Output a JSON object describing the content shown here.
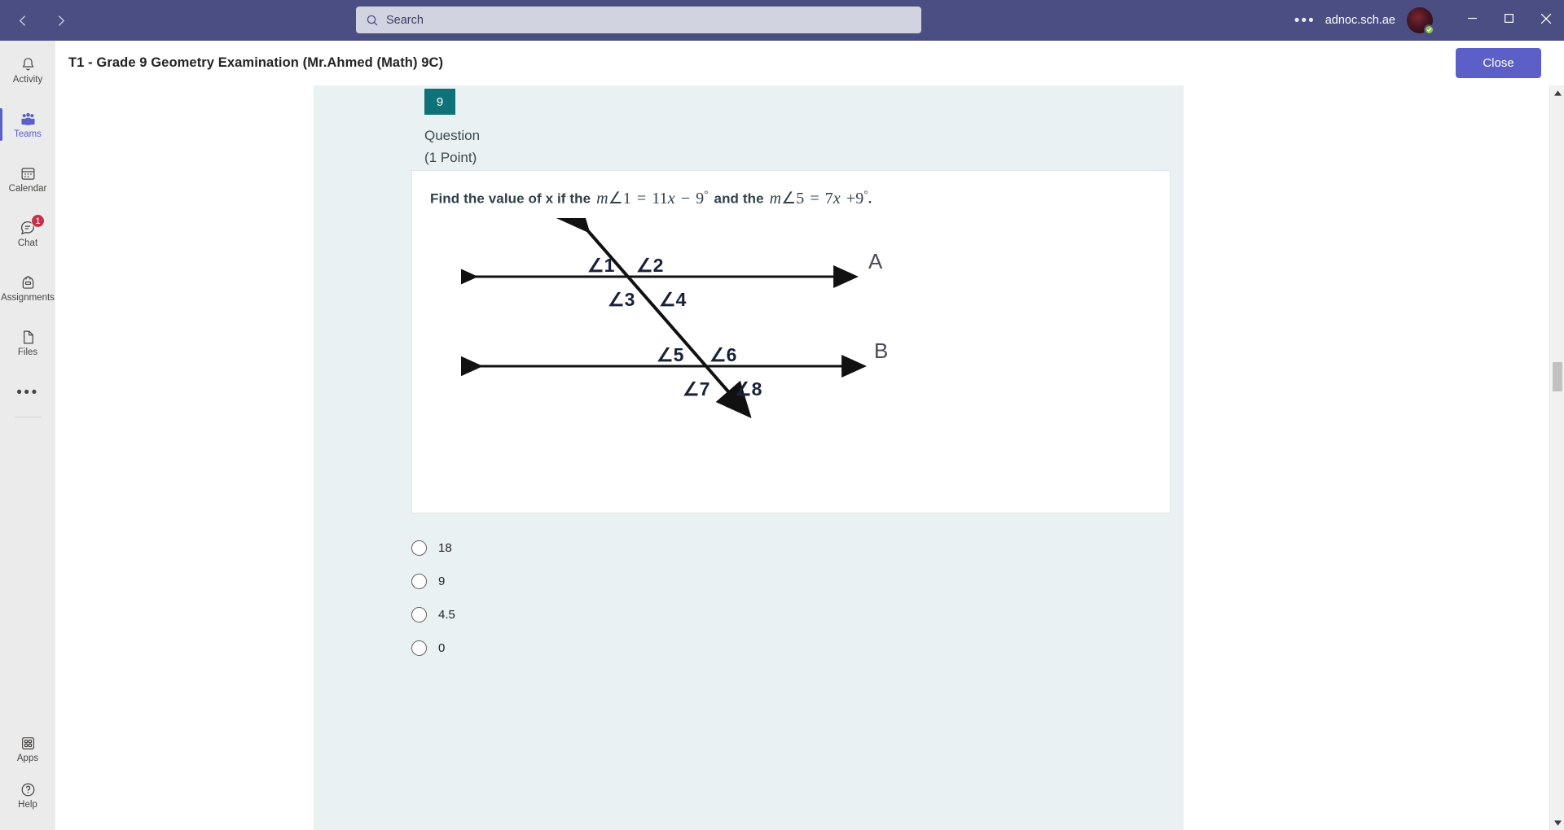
{
  "titlebar": {
    "back_icon": "chevron-left-icon",
    "forward_icon": "chevron-right-icon",
    "search": {
      "placeholder": "Search",
      "value": "",
      "icon": "search-icon"
    },
    "more_label": "•••",
    "tenant": "adnoc.sch.ae",
    "avatar_presence": "available",
    "minimize_label": "minimize-icon",
    "maximize_label": "maximize-icon",
    "close_label": "close-icon"
  },
  "rail": {
    "items": [
      {
        "label": "Activity",
        "icon": "bell-icon",
        "active": false,
        "badge": ""
      },
      {
        "label": "Teams",
        "icon": "people-icon",
        "active": true,
        "badge": ""
      },
      {
        "label": "Calendar",
        "icon": "calendar-icon",
        "active": false,
        "badge": ""
      },
      {
        "label": "Chat",
        "icon": "chat-icon",
        "active": false,
        "badge": "1"
      },
      {
        "label": "Assignments",
        "icon": "backpack-icon",
        "active": false,
        "badge": ""
      },
      {
        "label": "Files",
        "icon": "file-icon",
        "active": false,
        "badge": ""
      }
    ],
    "more_label": "•••",
    "bottom_items": [
      {
        "label": "Apps",
        "icon": "apps-grid-icon"
      },
      {
        "label": "Help",
        "icon": "help-circle-icon"
      }
    ]
  },
  "subheader": {
    "title": "T1 - Grade 9 Geometry Examination  (Mr.Ahmed (Math) 9C)",
    "close_label": "Close"
  },
  "question": {
    "number": "9",
    "label_line1": "Question",
    "label_line2": "(1 Point)",
    "prompt_prefix": "Find the value of x if the",
    "expr1_m": "m",
    "expr1_angle": "∠1",
    "expr1_eq": "=",
    "expr1_rhs_coef": "11",
    "expr1_rhs_var": "x",
    "expr1_minus": "−",
    "expr1_const": "9",
    "expr1_deg": "°",
    "prompt_mid": "and the",
    "expr2_m": "m",
    "expr2_angle": "∠5",
    "expr2_eq": "=",
    "expr2_rhs_coef": "7",
    "expr2_rhs_var": "x",
    "expr2_plus": "+",
    "expr2_const": "9",
    "expr2_deg": "°",
    "prompt_end": ".",
    "diagram": {
      "line_a_label": "A",
      "line_b_label": "B",
      "angles": [
        "∠1",
        "∠2",
        "∠3",
        "∠4",
        "∠5",
        "∠6",
        "∠7",
        "∠8"
      ]
    },
    "options": [
      {
        "label": "18",
        "selected": false
      },
      {
        "label": "9",
        "selected": false
      },
      {
        "label": "4.5",
        "selected": false
      },
      {
        "label": "0",
        "selected": false
      }
    ]
  },
  "colors": {
    "titlebar": "#4b4e82",
    "accent_purple": "#5b5fc7",
    "badge_teal": "#0f7278",
    "canvas": "#eaf1f2",
    "badge_red": "#c4314b",
    "presence_green": "#92c353"
  }
}
